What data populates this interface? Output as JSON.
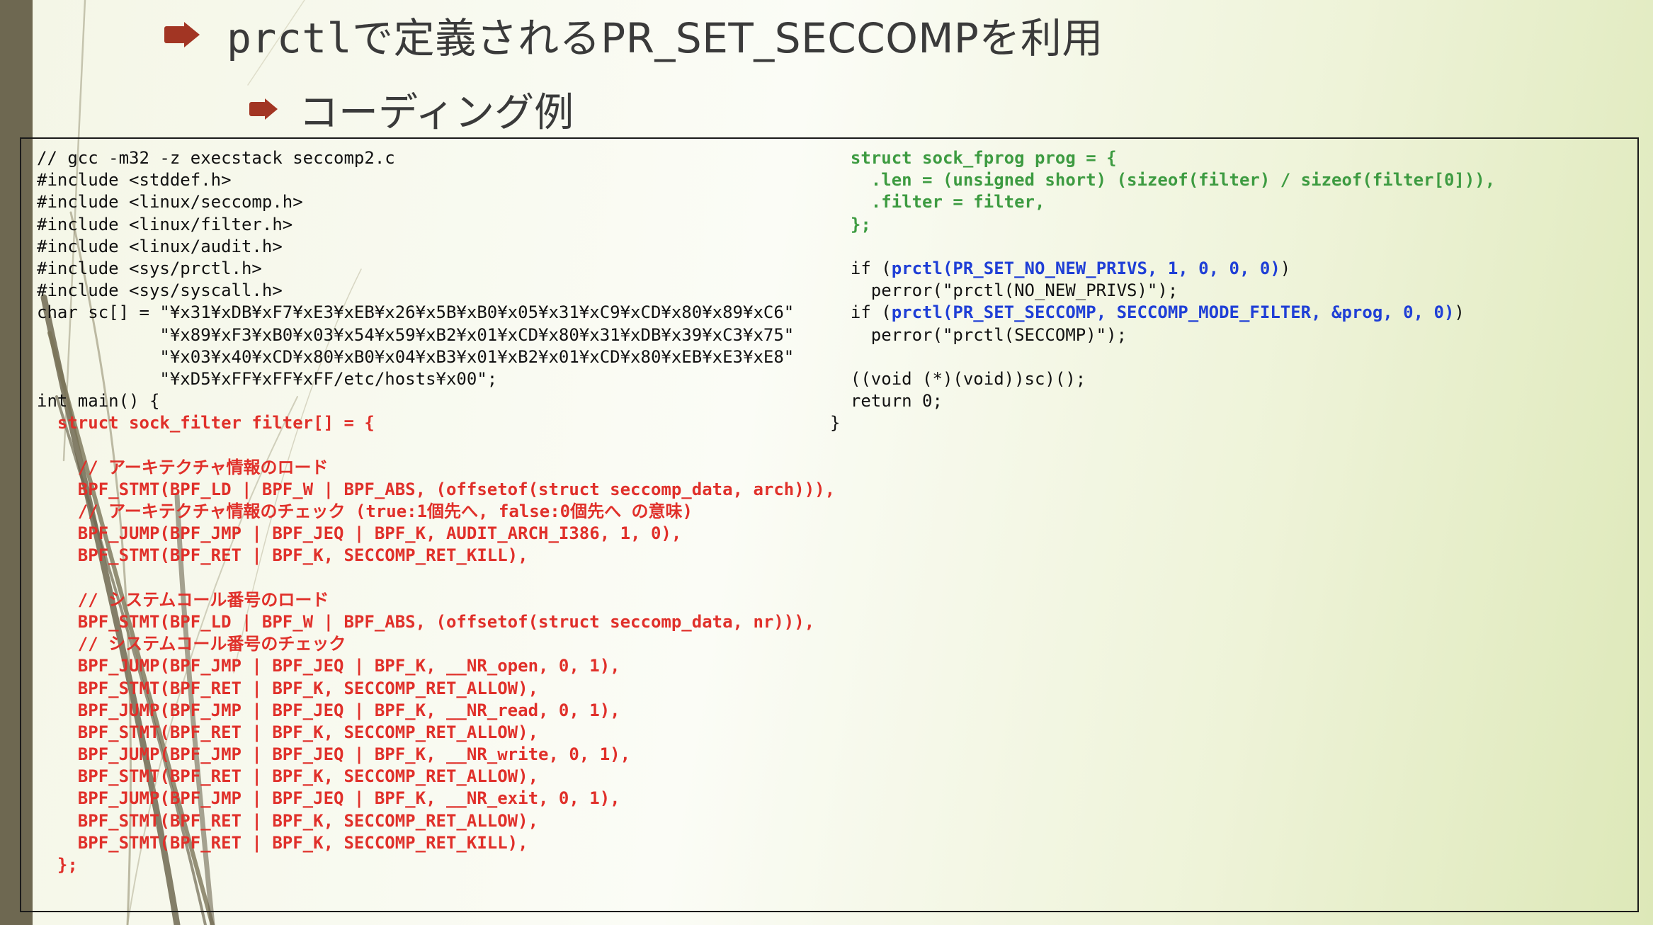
{
  "slide": {
    "title_prefix": "prctl",
    "title_rest": "で定義されるPR_SET_SECCOMPを利用",
    "subtitle": "コーディング例",
    "colors": {
      "accent_arrow": "#a23523",
      "left_bar": "#6e6851",
      "code_red": "#e0302a",
      "code_green": "#3d9b41",
      "code_blue": "#1f3fd6"
    }
  },
  "code": {
    "left": [
      {
        "text": "// gcc -m32 -z execstack seccomp2.c",
        "color": "black"
      },
      {
        "text": "#include <stddef.h>",
        "color": "black"
      },
      {
        "text": "#include <linux/seccomp.h>",
        "color": "black"
      },
      {
        "text": "#include <linux/filter.h>",
        "color": "black"
      },
      {
        "text": "#include <linux/audit.h>",
        "color": "black"
      },
      {
        "text": "#include <sys/prctl.h>",
        "color": "black"
      },
      {
        "text": "#include <sys/syscall.h>",
        "color": "black"
      },
      {
        "text": "char sc[] = \"¥x31¥xDB¥xF7¥xE3¥xEB¥x26¥x5B¥xB0¥x05¥x31¥xC9¥xCD¥x80¥x89¥xC6\"",
        "color": "black"
      },
      {
        "text": "            \"¥x89¥xF3¥xB0¥x03¥x54¥x59¥xB2¥x01¥xCD¥x80¥x31¥xDB¥x39¥xC3¥x75\"",
        "color": "black"
      },
      {
        "text": "            \"¥x03¥x40¥xCD¥x80¥xB0¥x04¥xB3¥x01¥xB2¥x01¥xCD¥x80¥xEB¥xE3¥xE8\"",
        "color": "black"
      },
      {
        "text": "            \"¥xD5¥xFF¥xFF¥xFF/etc/hosts¥x00\";",
        "color": "black"
      },
      {
        "text": "int main() {",
        "color": "black"
      },
      {
        "text": "  struct sock_filter filter[] = {",
        "color": "red"
      },
      {
        "text": "",
        "color": "red"
      },
      {
        "text": "    // アーキテクチャ情報のロード",
        "color": "red"
      },
      {
        "text": "    BPF_STMT(BPF_LD | BPF_W | BPF_ABS, (offsetof(struct seccomp_data, arch))),",
        "color": "red"
      },
      {
        "text": "    // アーキテクチャ情報のチェック (true:1個先へ, false:0個先へ の意味)",
        "color": "red"
      },
      {
        "text": "    BPF_JUMP(BPF_JMP | BPF_JEQ | BPF_K, AUDIT_ARCH_I386, 1, 0),",
        "color": "red"
      },
      {
        "text": "    BPF_STMT(BPF_RET | BPF_K, SECCOMP_RET_KILL),",
        "color": "red"
      },
      {
        "text": "",
        "color": "red"
      },
      {
        "text": "    // システムコール番号のロード",
        "color": "red"
      },
      {
        "text": "    BPF_STMT(BPF_LD | BPF_W | BPF_ABS, (offsetof(struct seccomp_data, nr))),",
        "color": "red"
      },
      {
        "text": "    // システムコール番号のチェック",
        "color": "red"
      },
      {
        "text": "    BPF_JUMP(BPF_JMP | BPF_JEQ | BPF_K, __NR_open, 0, 1),",
        "color": "red"
      },
      {
        "text": "    BPF_STMT(BPF_RET | BPF_K, SECCOMP_RET_ALLOW),",
        "color": "red"
      },
      {
        "text": "    BPF_JUMP(BPF_JMP | BPF_JEQ | BPF_K, __NR_read, 0, 1),",
        "color": "red"
      },
      {
        "text": "    BPF_STMT(BPF_RET | BPF_K, SECCOMP_RET_ALLOW),",
        "color": "red"
      },
      {
        "text": "    BPF_JUMP(BPF_JMP | BPF_JEQ | BPF_K, __NR_write, 0, 1),",
        "color": "red"
      },
      {
        "text": "    BPF_STMT(BPF_RET | BPF_K, SECCOMP_RET_ALLOW),",
        "color": "red"
      },
      {
        "text": "    BPF_JUMP(BPF_JMP | BPF_JEQ | BPF_K, __NR_exit, 0, 1),",
        "color": "red"
      },
      {
        "text": "    BPF_STMT(BPF_RET | BPF_K, SECCOMP_RET_ALLOW),",
        "color": "red"
      },
      {
        "text": "    BPF_STMT(BPF_RET | BPF_K, SECCOMP_RET_KILL),",
        "color": "red"
      },
      {
        "text": "  };",
        "color": "red"
      }
    ],
    "right": [
      {
        "text": "  struct sock_fprog prog = {",
        "color": "green"
      },
      {
        "text": "    .len = (unsigned short) (sizeof(filter) / sizeof(filter[0])),",
        "color": "green"
      },
      {
        "text": "    .filter = filter,",
        "color": "green"
      },
      {
        "text": "  };",
        "color": "green"
      },
      {
        "text": "",
        "color": "black"
      },
      {
        "parts": [
          {
            "text": "  if (",
            "color": "black"
          },
          {
            "text": "prctl(PR_SET_NO_NEW_PRIVS, 1, 0, 0, 0)",
            "color": "blue"
          },
          {
            "text": ")",
            "color": "black"
          }
        ]
      },
      {
        "text": "    perror(\"prctl(NO_NEW_PRIVS)\");",
        "color": "black"
      },
      {
        "parts": [
          {
            "text": "  if (",
            "color": "black"
          },
          {
            "text": "prctl(PR_SET_SECCOMP, SECCOMP_MODE_FILTER, &prog, 0, 0)",
            "color": "blue"
          },
          {
            "text": ")",
            "color": "black"
          }
        ]
      },
      {
        "text": "    perror(\"prctl(SECCOMP)\");",
        "color": "black"
      },
      {
        "text": "",
        "color": "black"
      },
      {
        "text": "  ((void (*)(void))sc)();",
        "color": "black"
      },
      {
        "text": "  return 0;",
        "color": "black"
      },
      {
        "text": "}",
        "color": "black"
      }
    ]
  }
}
